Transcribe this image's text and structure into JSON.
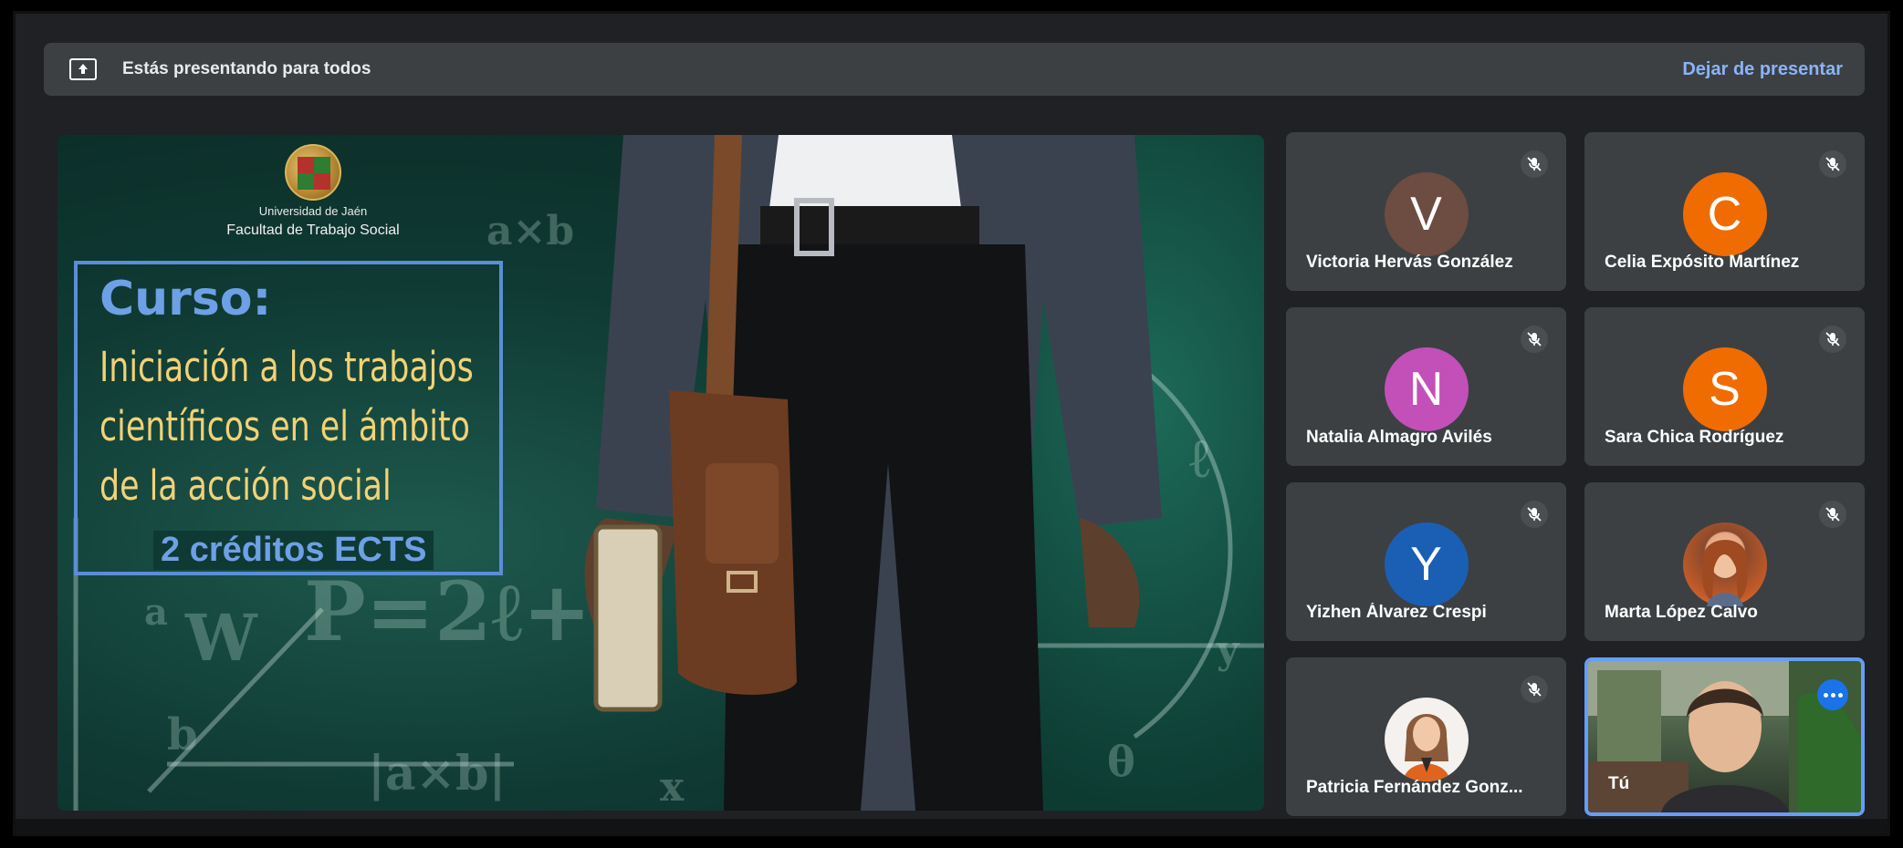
{
  "banner": {
    "icon": "present-screen-icon",
    "text": "Estás presentando para todos",
    "stop_label": "Dejar de presentar"
  },
  "slide": {
    "university": "Universidad de Jaén",
    "faculty": "Facultad de Trabajo Social",
    "course_label": "Curso:",
    "course_title_lines": [
      "Iniciación a los trabajos",
      "científicos en el ámbito",
      "de la acción social"
    ],
    "credits": "2 créditos ECTS",
    "board_text": [
      "P=2ℓ+2",
      "W",
      "a",
      "b",
      "|a×b|",
      "x",
      "y",
      "ℓ",
      "a×b",
      "θ"
    ]
  },
  "participants": [
    {
      "name": "Victoria Hervás González",
      "initial": "V",
      "color": "#6d4c41",
      "muted": true
    },
    {
      "name": "Celia Expósito Martínez",
      "initial": "C",
      "color": "#f06c00",
      "muted": true
    },
    {
      "name": "Natalia Almagro Avilés",
      "initial": "N",
      "color": "#c250b8",
      "muted": true
    },
    {
      "name": "Sara Chica Rodríguez",
      "initial": "S",
      "color": "#f06c00",
      "muted": true
    },
    {
      "name": "Yizhen Álvarez Crespi",
      "initial": "Y",
      "color": "#1a5fb4",
      "muted": true
    },
    {
      "name": "Marta López Calvo",
      "initial": "",
      "photo": true,
      "muted": true
    },
    {
      "name": "Patricia Fernández Gonz...",
      "initial": "",
      "photo": true,
      "muted": true
    },
    {
      "name": "Tú",
      "self": true
    }
  ],
  "colors": {
    "background": "#202124",
    "tile": "#3c4043",
    "link": "#8ab4f8",
    "accent": "#1a73e8",
    "title_yellow": "#f2d276",
    "title_blue": "#6ea0e6"
  }
}
